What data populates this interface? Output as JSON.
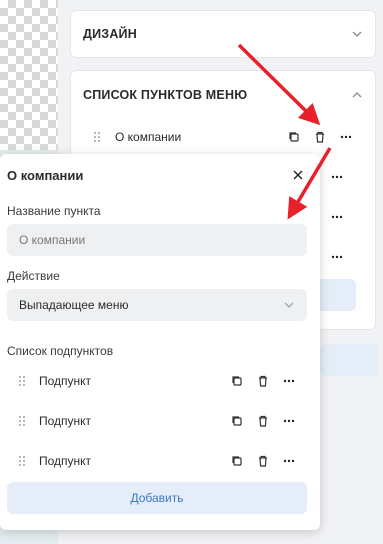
{
  "design_section": {
    "title": "ДИЗАЙН"
  },
  "menu_section": {
    "title": "СПИСОК ПУНКТОВ МЕНЮ",
    "items": [
      {
        "label": "О компании"
      }
    ]
  },
  "popup": {
    "title": "О компании",
    "name_label": "Название пункта",
    "name_value": "О компании",
    "action_label": "Действие",
    "action_value": "Выпадающее меню",
    "subitems_label": "Список подпунктов",
    "subitems": [
      {
        "label": "Подпункт"
      },
      {
        "label": "Подпункт"
      },
      {
        "label": "Подпункт"
      }
    ],
    "add_label": "Добавить"
  },
  "colors": {
    "arrow": "#e8202a",
    "accent": "#3b78c3",
    "button_bg": "#e4edf8"
  }
}
